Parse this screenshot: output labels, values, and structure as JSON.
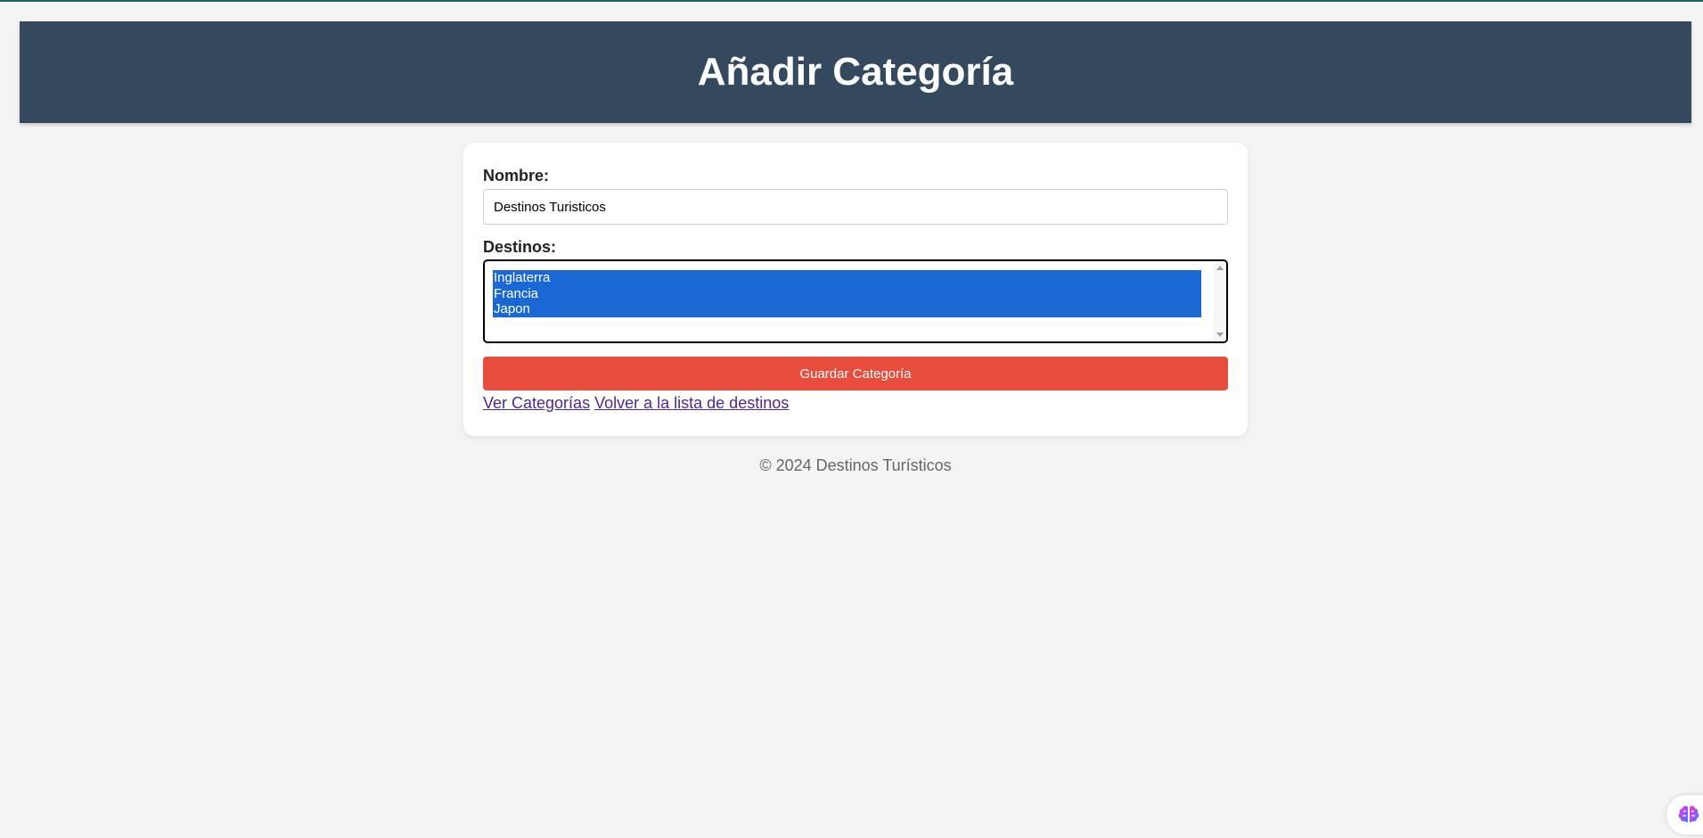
{
  "header": {
    "title": "Añadir Categoría"
  },
  "form": {
    "name_label": "Nombre:",
    "name_value": "Destinos Turisticos",
    "destinations_label": "Destinos:",
    "destinations_options": [
      "Inglaterra",
      "Francia",
      "Japon"
    ],
    "save_label": "Guardar Categoría"
  },
  "links": {
    "view_categories": "Ver Categorías",
    "back_to_list": "Volver a la lista de destinos"
  },
  "footer": {
    "text": "© 2024 Destinos Turísticos"
  },
  "colors": {
    "header_bg": "#34495e",
    "button_bg": "#e74c3c",
    "selection_bg": "#1a67d6",
    "link": "#4b2a8b"
  },
  "icons": {
    "assistant_widget": "brain-icon"
  }
}
